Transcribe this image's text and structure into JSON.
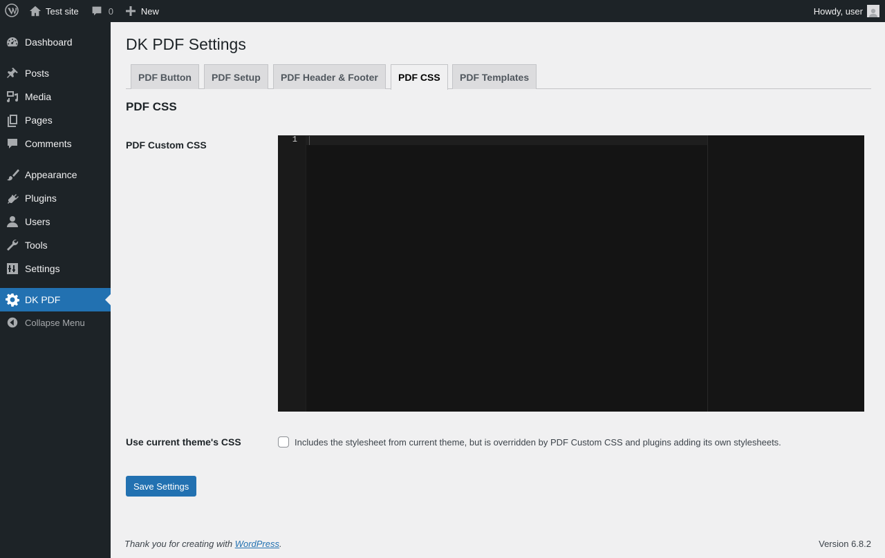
{
  "adminbar": {
    "site_name": "Test site",
    "comments_count": "0",
    "new_label": "New",
    "howdy": "Howdy, user"
  },
  "sidebar": {
    "items": [
      {
        "label": "Dashboard",
        "icon": "dashboard-icon"
      },
      {
        "label": "Posts",
        "icon": "pin-icon"
      },
      {
        "label": "Media",
        "icon": "media-icon"
      },
      {
        "label": "Pages",
        "icon": "pages-icon"
      },
      {
        "label": "Comments",
        "icon": "comment-icon"
      },
      {
        "label": "Appearance",
        "icon": "brush-icon"
      },
      {
        "label": "Plugins",
        "icon": "plug-icon"
      },
      {
        "label": "Users",
        "icon": "user-icon"
      },
      {
        "label": "Tools",
        "icon": "wrench-icon"
      },
      {
        "label": "Settings",
        "icon": "settings-icon"
      },
      {
        "label": "DK PDF",
        "icon": "gear-icon",
        "active": true
      }
    ],
    "collapse_label": "Collapse Menu"
  },
  "page": {
    "title": "DK PDF Settings",
    "tabs": [
      {
        "label": "PDF Button"
      },
      {
        "label": "PDF Setup"
      },
      {
        "label": "PDF Header & Footer"
      },
      {
        "label": "PDF CSS",
        "active": true
      },
      {
        "label": "PDF Templates"
      }
    ],
    "section_title": "PDF CSS",
    "custom_css_label": "PDF Custom CSS",
    "editor": {
      "line_number": "1",
      "content": ""
    },
    "theme_css_label": "Use current theme's CSS",
    "theme_css_checked": false,
    "theme_css_description": "Includes the stylesheet from current theme, but is overridden by PDF Custom CSS and plugins adding its own stylesheets.",
    "save_label": "Save Settings"
  },
  "footer": {
    "thanks_prefix": "Thank you for creating with ",
    "wordpress_link": "WordPress",
    "thanks_suffix": ".",
    "version": "Version 6.8.2"
  },
  "colors": {
    "adminbar_bg": "#1d2327",
    "accent": "#2271b1",
    "editor_bg": "#141414",
    "page_bg": "#f0f0f1"
  }
}
